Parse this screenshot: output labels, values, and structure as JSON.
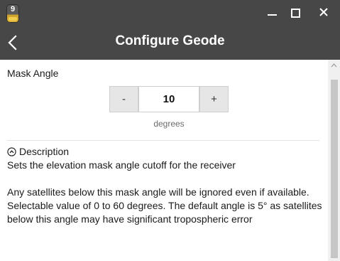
{
  "titlebar": {
    "app_icon_label": "9",
    "min_icon": "minimize-icon",
    "max_icon": "maximize-icon",
    "close_icon": "close-icon"
  },
  "nav": {
    "back_icon": "chevron-left-icon",
    "title": "Configure Geode"
  },
  "mask_angle": {
    "label": "Mask Angle",
    "minus_label": "-",
    "value": "10",
    "plus_label": "+",
    "units": "degrees"
  },
  "description": {
    "toggle_icon": "chevron-up-circle-icon",
    "title": "Description",
    "summary": "Sets the elevation mask angle cutoff for the receiver",
    "detail": "Any satellites below this mask angle will be ignored even if available.  Selectable value of 0 to 60 degrees. The default angle is 5° as satellites below this angle may have significant tropospheric error"
  },
  "colors": {
    "header_bg": "#474747",
    "scrollbar_thumb": "#c6c6c6"
  }
}
